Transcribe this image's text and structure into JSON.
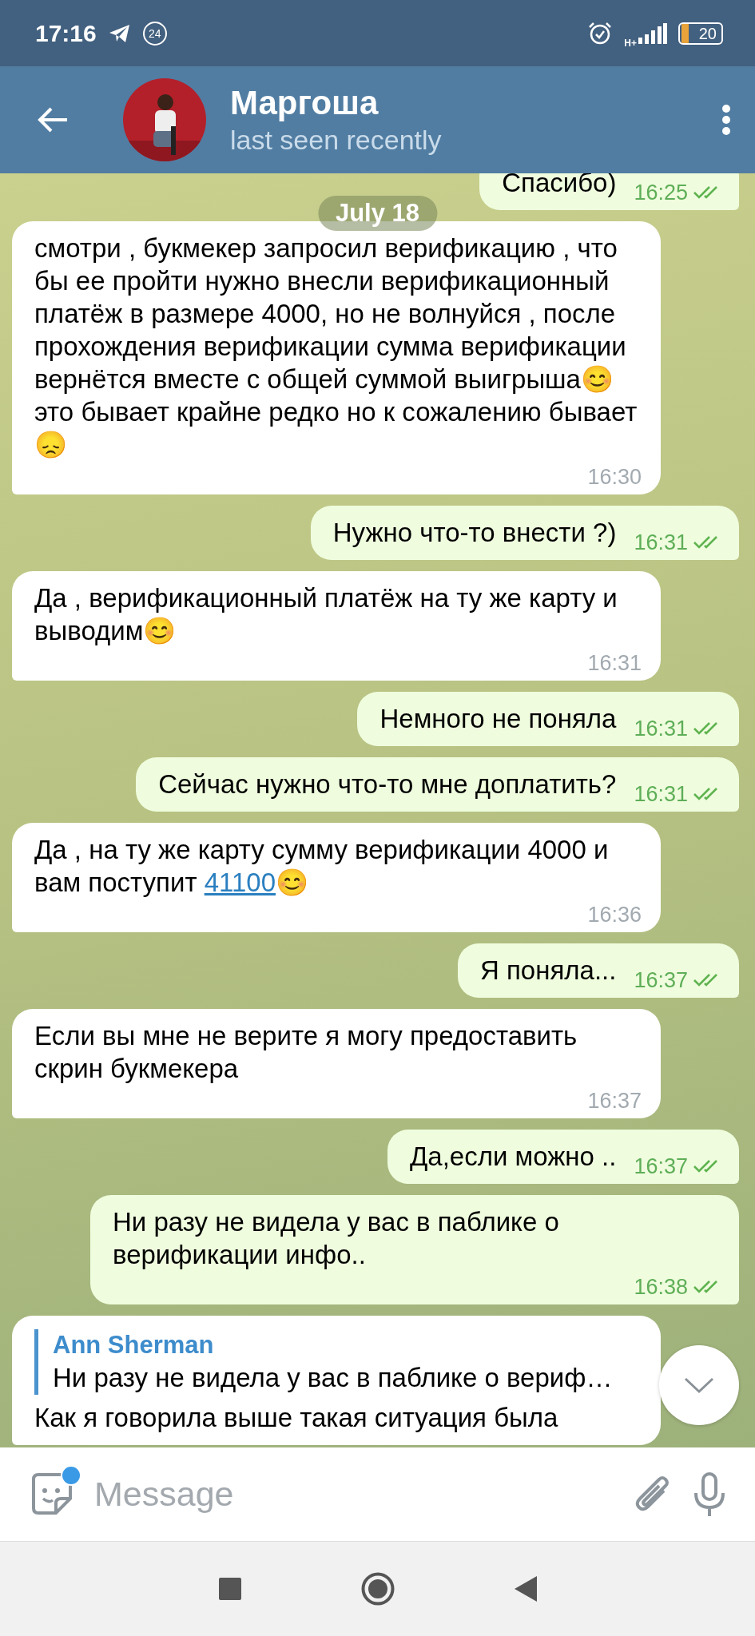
{
  "status_bar": {
    "time": "17:16",
    "notification_count": "24",
    "network": "H+",
    "battery": "20"
  },
  "header": {
    "name": "Маргоша",
    "status": "last seen recently"
  },
  "date_badge": "July 18",
  "messages": [
    {
      "kind": "outgoing",
      "segments": [
        {
          "kind": "text",
          "text": "Спасибо)"
        }
      ],
      "time": "16:25",
      "read": true
    },
    {
      "kind": "incoming",
      "segments": [
        {
          "kind": "text",
          "text": "смотри , букмекер запросил верификацию , что бы ее пройти нужно внесли верификационный платёж в размере 4000, но не волнуйся , после прохождения верификации сумма верификации вернётся вместе с общей суммой выигрыша😊это бывает крайне редко но к сожалению бывает 😞"
        }
      ],
      "time": "16:30"
    },
    {
      "kind": "outgoing",
      "segments": [
        {
          "kind": "text",
          "text": "Нужно что-то внести ?)"
        }
      ],
      "time": "16:31",
      "read": true
    },
    {
      "kind": "incoming",
      "segments": [
        {
          "kind": "text",
          "text": "Да , верификационный платёж на ту же карту и выводим😊"
        }
      ],
      "time": "16:31"
    },
    {
      "kind": "outgoing",
      "segments": [
        {
          "kind": "text",
          "text": "Немного не поняла"
        }
      ],
      "time": "16:31",
      "read": true
    },
    {
      "kind": "outgoing",
      "segments": [
        {
          "kind": "text",
          "text": "Сейчас нужно что-то мне доплатить?"
        }
      ],
      "time": "16:31",
      "read": true
    },
    {
      "kind": "incoming",
      "segments": [
        {
          "kind": "text",
          "text": "Да , на ту же карту сумму верификации 4000 и вам поступит "
        },
        {
          "kind": "link",
          "text": "41100"
        },
        {
          "kind": "text",
          "text": "😊"
        }
      ],
      "time": "16:36"
    },
    {
      "kind": "outgoing",
      "segments": [
        {
          "kind": "text",
          "text": "Я поняла..."
        }
      ],
      "time": "16:37",
      "read": true
    },
    {
      "kind": "incoming",
      "segments": [
        {
          "kind": "text",
          "text": "Если вы мне не верите я могу предоставить скрин букмекера"
        }
      ],
      "time": "16:37"
    },
    {
      "kind": "outgoing",
      "segments": [
        {
          "kind": "text",
          "text": "Да,если можно .."
        }
      ],
      "time": "16:37",
      "read": true
    },
    {
      "kind": "outgoing",
      "segments": [
        {
          "kind": "text",
          "text": "Ни разу не видела у вас в паблике о верификации инфо.."
        }
      ],
      "time": "16:38",
      "read": true
    },
    {
      "kind": "incoming",
      "reply": {
        "author": "Ann Sherman",
        "text": "Ни разу не видела у вас в паблике о вериф…"
      },
      "segments": [
        {
          "kind": "text",
          "text": "Как я говорила выше такая ситуация была"
        }
      ]
    }
  ],
  "input": {
    "placeholder": "Message",
    "sticker_badge": true
  }
}
